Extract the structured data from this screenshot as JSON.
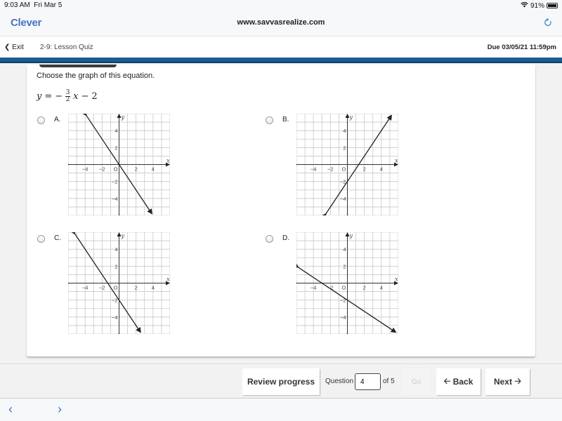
{
  "status_bar": {
    "time": "9:03 AM",
    "date": "Fri Mar 5",
    "battery": "91%",
    "battery_level": 0.91
  },
  "browser": {
    "brand": "Clever",
    "url": "www.savvasrealize.com",
    "reload_icon": "reload-icon"
  },
  "nav": {
    "exit_label": "Exit",
    "quiz_title": "2-9: Lesson Quiz",
    "due": "Due 03/05/21 11:59pm"
  },
  "question": {
    "prompt": "Choose the graph of this equation.",
    "equation": {
      "lhs": "y",
      "eq": "=",
      "neg": "−",
      "num": "3",
      "den": "2",
      "var": "x",
      "minus": "−",
      "const": "2"
    }
  },
  "options": [
    {
      "label": "A.",
      "slope": -1.5,
      "intercept": 0
    },
    {
      "label": "B.",
      "slope": 1.5,
      "intercept": -2
    },
    {
      "label": "C.",
      "slope": -1.5,
      "intercept": -2
    },
    {
      "label": "D.",
      "slope": -0.6667,
      "intercept": -2
    }
  ],
  "graph_axes": {
    "x_label": "x",
    "y_label": "y",
    "origin_label": "O",
    "x_ticks": [
      "−4",
      "−2",
      "2",
      "4"
    ],
    "y_ticks": [
      "4",
      "2",
      "−2",
      "−4"
    ],
    "range": [
      -6,
      6
    ]
  },
  "footer": {
    "review_label": "Review progress",
    "question_label": "Question",
    "question_value": "4",
    "of_label": "of 5",
    "go_label": "Go",
    "back_label": "Back",
    "next_label": "Next"
  }
}
